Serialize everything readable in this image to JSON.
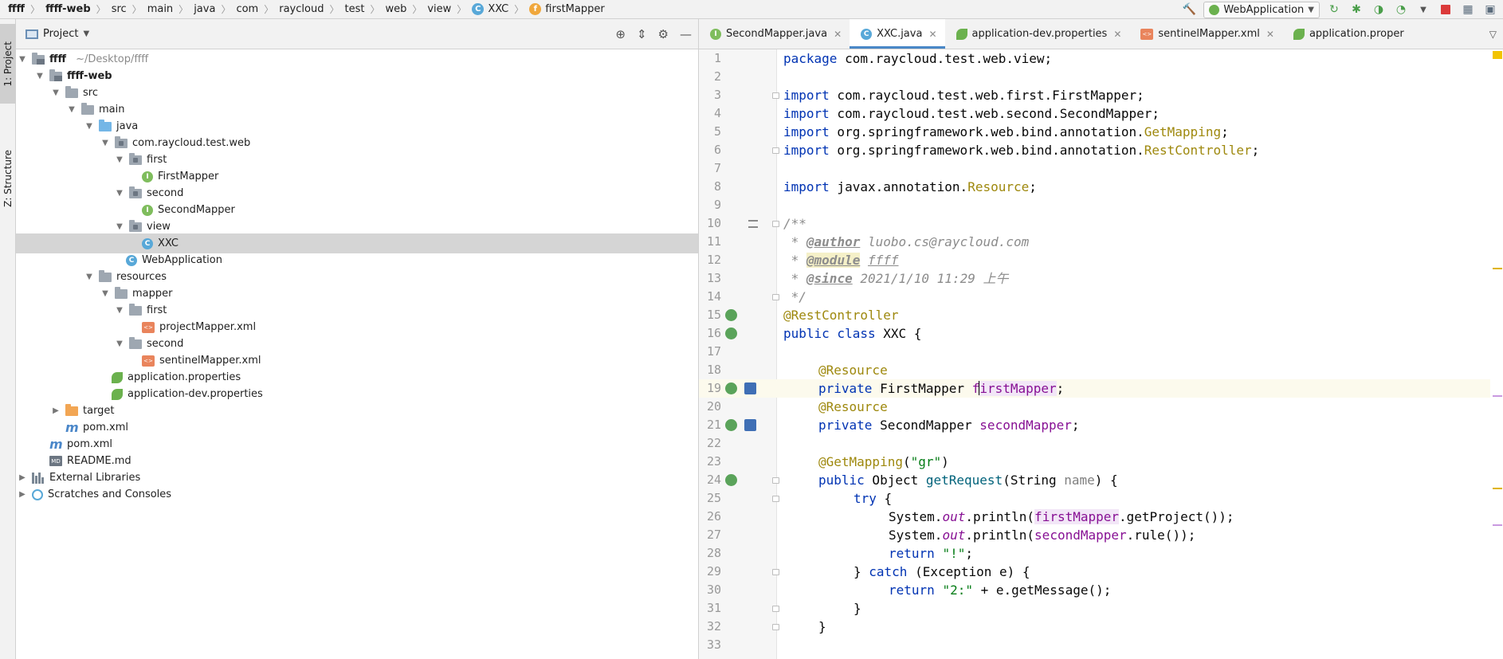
{
  "breadcrumb": {
    "items": [
      "ffff",
      "ffff-web",
      "src",
      "main",
      "java",
      "com",
      "raycloud",
      "test",
      "web",
      "view",
      "XXC",
      "firstMapper"
    ]
  },
  "toolbar": {
    "run_config": "WebApplication"
  },
  "toolstrip": {
    "project_tab": "1: Project",
    "structure_tab": "Z: Structure"
  },
  "project_panel": {
    "title": "Project"
  },
  "tree": {
    "root_name": "ffff",
    "root_path": "~/Desktop/ffff",
    "module": "ffff-web",
    "src": "src",
    "main": "main",
    "java": "java",
    "package": "com.raycloud.test.web",
    "first": "first",
    "first_mapper": "FirstMapper",
    "second": "second",
    "second_mapper": "SecondMapper",
    "view": "view",
    "xxc": "XXC",
    "web_application": "WebApplication",
    "resources": "resources",
    "mapper": "mapper",
    "mapper_first": "first",
    "project_mapper_xml": "projectMapper.xml",
    "mapper_second": "second",
    "sentinel_mapper_xml": "sentinelMapper.xml",
    "application_properties": "application.properties",
    "application_dev_properties": "application-dev.properties",
    "target": "target",
    "module_pom": "pom.xml",
    "root_pom": "pom.xml",
    "readme": "README.md",
    "external_libraries": "External Libraries",
    "scratches": "Scratches and Consoles"
  },
  "tabs": [
    {
      "label": "SecondMapper.java"
    },
    {
      "label": "XXC.java"
    },
    {
      "label": "application-dev.properties"
    },
    {
      "label": "sentinelMapper.xml"
    },
    {
      "label": "application.proper"
    }
  ],
  "editor": {
    "line_numbers": [
      "1",
      "2",
      "3",
      "4",
      "5",
      "6",
      "7",
      "8",
      "9",
      "10",
      "11",
      "12",
      "13",
      "14",
      "15",
      "16",
      "17",
      "18",
      "19",
      "20",
      "21",
      "22",
      "23",
      "24",
      "25",
      "26",
      "27",
      "28",
      "29",
      "30",
      "31",
      "32",
      "33"
    ],
    "tok": {
      "package_kw": "package",
      "package_name": " com.raycloud.test.web.view;",
      "import_kw": "import",
      "imp3": " com.raycloud.test.web.first.FirstMapper;",
      "imp4": " com.raycloud.test.web.second.SecondMapper;",
      "imp5a": " org.springframework.web.bind.annotation.",
      "imp5b": "GetMapping",
      "imp6a": " org.springframework.web.bind.annotation.",
      "imp6b": "RestController",
      "imp8a": " javax.annotation.",
      "imp8b": "Resource",
      "semi": ";",
      "doc_open": "/**",
      "doc_star": " * ",
      "author_tag": "@author",
      "author_val": " luobo.cs@raycloud.com",
      "module_tag": "@module",
      "module_val": "ffff",
      "since_tag": "@since",
      "since_val": " 2021/1/10 11:29 上午",
      "doc_close": " */",
      "rest_controller": "@RestController",
      "public_class": "public class",
      "class_decl": " XXC {",
      "resource_ann": "@Resource",
      "private_kw": "private",
      "first_type": " FirstMapper ",
      "first_field_a": "f",
      "first_field_b": "irstMapper",
      "second_type": " SecondMapper ",
      "second_field": "secondMapper",
      "get_mapping": "@GetMapping",
      "get_mapping_arg_open": "(",
      "get_mapping_arg": "\"gr\"",
      "get_mapping_arg_close": ")",
      "public_kw": "public",
      "method_sig_a": " Object ",
      "method_name": "getRequest",
      "method_sig_b": "(String ",
      "method_param": "name",
      "method_sig_c": ") {",
      "try_kw": "try",
      "brace_open": " {",
      "sys": "System.",
      "out": "out",
      "println_a": ".println(",
      "call_first_b": ".getProject());",
      "call_second_b": ".rule());",
      "return_kw": "return",
      "ret_str": "\"!\"",
      "catch_a": "} ",
      "catch_kw": "catch",
      "catch_b": " (Exception e) {",
      "ret2_str": "\"2:\"",
      "ret2_b": " + e.getMessage();",
      "brace_close": "}"
    }
  }
}
